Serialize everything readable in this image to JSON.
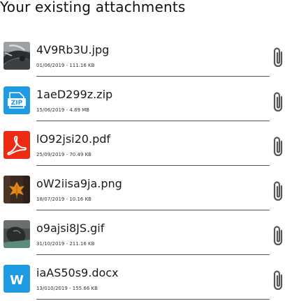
{
  "page": {
    "title": "Your existing attachments"
  },
  "colors": {
    "zip_tile": "#1e9be2",
    "pdf_tile": "#ee2a12",
    "docx_tile": "#1e9be2",
    "divider": "#555555",
    "clip_icon": "#555555"
  },
  "attachments": [
    {
      "filename": "4V9Rb3U.jpg",
      "meta": "01/06/2019 - 111.16 KB",
      "thumbnail": "photo-thumbnail",
      "action_icon": "paperclip-icon"
    },
    {
      "filename": "1aeD299z.zip",
      "meta": "15/06/2019 - 4.89 MB",
      "thumbnail": "zip-file-icon",
      "thumbnail_text": "ZIP",
      "action_icon": "paperclip-icon"
    },
    {
      "filename": "lO92jsi20.pdf",
      "meta": "25/09/2019 - 70.49 KB",
      "thumbnail": "pdf-file-icon",
      "action_icon": "paperclip-icon"
    },
    {
      "filename": "oW2iisa9ja.png",
      "meta": "18/07/2019 - 10.16 KB",
      "thumbnail": "leaf-photo-thumbnail",
      "action_icon": "paperclip-icon"
    },
    {
      "filename": "o9ajsi8JS.gif",
      "meta": "31/10/2019 - 211.16 KB",
      "thumbnail": "rock-photo-thumbnail",
      "action_icon": "paperclip-icon"
    },
    {
      "filename": "iaAS50s9.docx",
      "meta": "13/010/2019 - 155.66 KB",
      "thumbnail": "word-file-icon",
      "thumbnail_text": "W",
      "action_icon": "paperclip-icon"
    }
  ]
}
